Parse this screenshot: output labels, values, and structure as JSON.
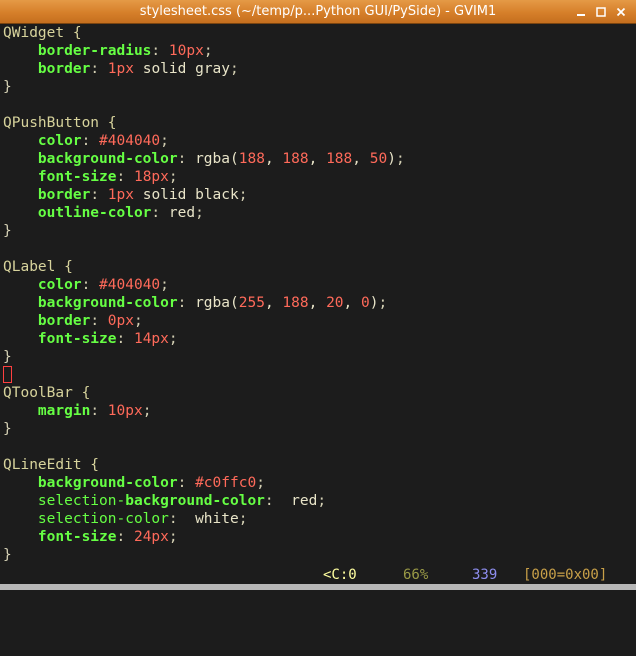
{
  "window": {
    "title": "stylesheet.css (~/temp/p...Python GUI/PySide) - GVIM1",
    "buttons": [
      {
        "name": "minimize",
        "icon": "minimize-icon"
      },
      {
        "name": "maximize",
        "icon": "maximize-icon"
      },
      {
        "name": "close",
        "icon": "close-icon"
      }
    ]
  },
  "editor": {
    "colors": {
      "background": "#1c1c1c",
      "selector": "#d7d39c",
      "property": "#66ff44",
      "number": "#ff6a5a",
      "text": "#d4d0b4",
      "cursor": "#ff4040"
    },
    "lines": [
      {
        "t": [
          [
            "sel",
            "QWidget {"
          ]
        ]
      },
      {
        "t": [
          [
            "sp",
            "    "
          ],
          [
            "prop",
            "border-radius"
          ],
          [
            "punct",
            ": "
          ],
          [
            "num",
            "10px"
          ],
          [
            "punct",
            ";"
          ]
        ]
      },
      {
        "t": [
          [
            "sp",
            "    "
          ],
          [
            "prop",
            "border"
          ],
          [
            "punct",
            ": "
          ],
          [
            "num",
            "1px"
          ],
          [
            "val",
            " solid gray"
          ],
          [
            "punct",
            ";"
          ]
        ]
      },
      {
        "t": [
          [
            "punct",
            "}"
          ]
        ]
      },
      {
        "t": []
      },
      {
        "t": [
          [
            "sel",
            "QPushButton {"
          ]
        ]
      },
      {
        "t": [
          [
            "sp",
            "    "
          ],
          [
            "prop",
            "color"
          ],
          [
            "punct",
            ": "
          ],
          [
            "color",
            "#404040"
          ],
          [
            "punct",
            ";"
          ]
        ]
      },
      {
        "t": [
          [
            "sp",
            "    "
          ],
          [
            "prop",
            "background-color"
          ],
          [
            "punct",
            ": "
          ],
          [
            "val",
            "rgba("
          ],
          [
            "num",
            "188"
          ],
          [
            "val",
            ", "
          ],
          [
            "num",
            "188"
          ],
          [
            "val",
            ", "
          ],
          [
            "num",
            "188"
          ],
          [
            "val",
            ", "
          ],
          [
            "num",
            "50"
          ],
          [
            "val",
            ")"
          ],
          [
            "punct",
            ";"
          ]
        ]
      },
      {
        "t": [
          [
            "sp",
            "    "
          ],
          [
            "prop",
            "font-size"
          ],
          [
            "punct",
            ": "
          ],
          [
            "num",
            "18px"
          ],
          [
            "punct",
            ";"
          ]
        ]
      },
      {
        "t": [
          [
            "sp",
            "    "
          ],
          [
            "prop",
            "border"
          ],
          [
            "punct",
            ": "
          ],
          [
            "num",
            "1px"
          ],
          [
            "val",
            " solid black"
          ],
          [
            "punct",
            ";"
          ]
        ]
      },
      {
        "t": [
          [
            "sp",
            "    "
          ],
          [
            "prop",
            "outline-color"
          ],
          [
            "punct",
            ": "
          ],
          [
            "val",
            "red"
          ],
          [
            "punct",
            ";"
          ]
        ]
      },
      {
        "t": [
          [
            "punct",
            "}"
          ]
        ]
      },
      {
        "t": []
      },
      {
        "t": [
          [
            "sel",
            "QLabel {"
          ]
        ]
      },
      {
        "t": [
          [
            "sp",
            "    "
          ],
          [
            "prop",
            "color"
          ],
          [
            "punct",
            ": "
          ],
          [
            "color",
            "#404040"
          ],
          [
            "punct",
            ";"
          ]
        ]
      },
      {
        "t": [
          [
            "sp",
            "    "
          ],
          [
            "prop",
            "background-color"
          ],
          [
            "punct",
            ": "
          ],
          [
            "val",
            "rgba("
          ],
          [
            "num",
            "255"
          ],
          [
            "val",
            ", "
          ],
          [
            "num",
            "188"
          ],
          [
            "val",
            ", "
          ],
          [
            "num",
            "20"
          ],
          [
            "val",
            ", "
          ],
          [
            "num",
            "0"
          ],
          [
            "val",
            ")"
          ],
          [
            "punct",
            ";"
          ]
        ]
      },
      {
        "t": [
          [
            "sp",
            "    "
          ],
          [
            "prop",
            "border"
          ],
          [
            "punct",
            ": "
          ],
          [
            "num",
            "0px"
          ],
          [
            "punct",
            ";"
          ]
        ]
      },
      {
        "t": [
          [
            "sp",
            "    "
          ],
          [
            "prop",
            "font-size"
          ],
          [
            "punct",
            ": "
          ],
          [
            "num",
            "14px"
          ],
          [
            "punct",
            ";"
          ]
        ]
      },
      {
        "t": [
          [
            "punct",
            "}"
          ]
        ]
      },
      {
        "t": [],
        "cursor": true
      },
      {
        "t": [
          [
            "sel",
            "QToolBar {"
          ]
        ]
      },
      {
        "t": [
          [
            "sp",
            "    "
          ],
          [
            "prop",
            "margin"
          ],
          [
            "punct",
            ": "
          ],
          [
            "num",
            "10px"
          ],
          [
            "punct",
            ";"
          ]
        ]
      },
      {
        "t": [
          [
            "punct",
            "}"
          ]
        ]
      },
      {
        "t": []
      },
      {
        "t": [
          [
            "sel",
            "QLineEdit {"
          ]
        ]
      },
      {
        "t": [
          [
            "sp",
            "    "
          ],
          [
            "prop",
            "background-color"
          ],
          [
            "punct",
            ": "
          ],
          [
            "color",
            "#c0ffc0"
          ],
          [
            "punct",
            ";"
          ]
        ]
      },
      {
        "t": [
          [
            "sp",
            "    "
          ],
          [
            "prop-plain",
            "selection-"
          ],
          [
            "prop",
            "background-color"
          ],
          [
            "punct",
            ":  "
          ],
          [
            "val",
            "red"
          ],
          [
            "punct",
            ";"
          ]
        ]
      },
      {
        "t": [
          [
            "sp",
            "    "
          ],
          [
            "prop-plain",
            "selection-color"
          ],
          [
            "punct",
            ":  "
          ],
          [
            "val",
            "white"
          ],
          [
            "punct",
            ";"
          ]
        ]
      },
      {
        "t": [
          [
            "sp",
            "    "
          ],
          [
            "prop",
            "font-size"
          ],
          [
            "punct",
            ": "
          ],
          [
            "num",
            "24px"
          ],
          [
            "punct",
            ";"
          ]
        ]
      },
      {
        "t": [
          [
            "punct",
            "}"
          ]
        ]
      }
    ]
  },
  "status": {
    "position": "<C:0",
    "percent": "66%",
    "chars": "339",
    "byte": "[000=0x00]",
    "colors": {
      "position": "#ffffa0",
      "percent": "#9a9a46",
      "chars": "#8e8ef0",
      "byte": "#c8a048"
    }
  }
}
